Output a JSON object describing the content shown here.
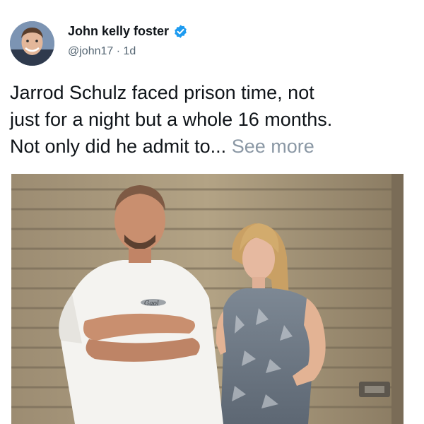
{
  "tweet": {
    "author": {
      "display_name": "John kelly foster",
      "handle": "@john17",
      "time_separator": "·",
      "relative_time": "1d",
      "verified": true,
      "verified_icon": "verified-badge-icon",
      "avatar": "avatar-photo"
    },
    "text": {
      "line1": "Jarrod Schulz faced prison time, not",
      "line2": "just for a night but a whole 16 months.",
      "line3": "Not only did he admit to...",
      "see_more": "See more"
    },
    "media": {
      "type": "photo",
      "shirt_logo_text": "Gaol"
    }
  },
  "colors": {
    "verified_blue": "#1d9bf0",
    "muted_text": "#536471",
    "see_more": "#8b98a5"
  }
}
